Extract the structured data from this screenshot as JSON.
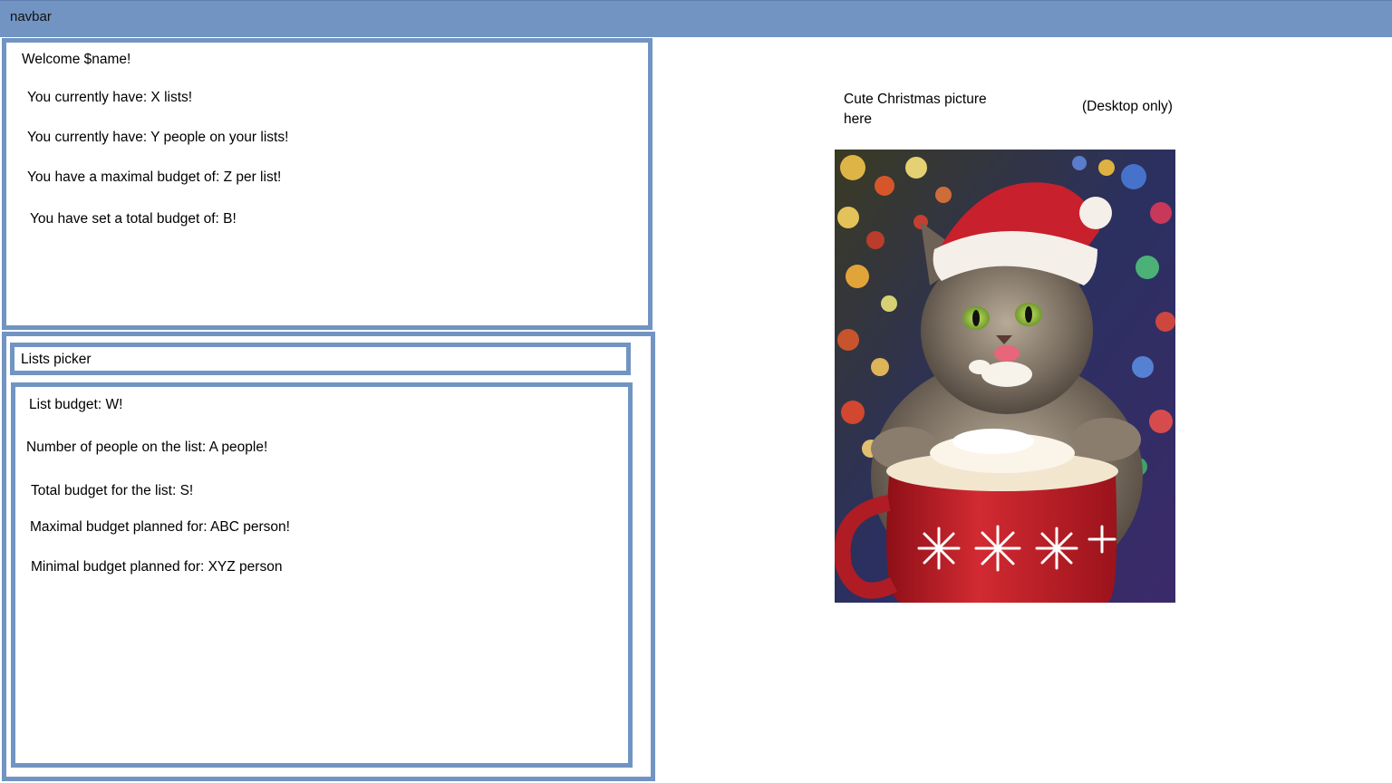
{
  "navbar": {
    "label": "navbar"
  },
  "welcome": {
    "greeting": "Welcome $name!",
    "lists_count": "You currently have: X lists!",
    "people_count": "You currently have: Y people on your lists!",
    "max_budget": "You have a maximal budget of: Z per list!",
    "total_budget": "You have set a total budget of: B!"
  },
  "lists": {
    "picker_label": "Lists picker",
    "list_budget": "List budget: W!",
    "people_on_list": "Number of people on the list: A people!",
    "total_list_budget": "Total budget for the list: S!",
    "max_planned": "Maximal budget planned for: ABC person!",
    "min_planned": "Minimal budget planned for: XYZ person"
  },
  "picture": {
    "caption": "Cute Christmas picture here",
    "note": "(Desktop only)",
    "image_icon": "christmas-cat-photo"
  },
  "colors": {
    "accent": "#7194c2",
    "hat_red": "#c8202c",
    "mug_red": "#c41a24"
  }
}
